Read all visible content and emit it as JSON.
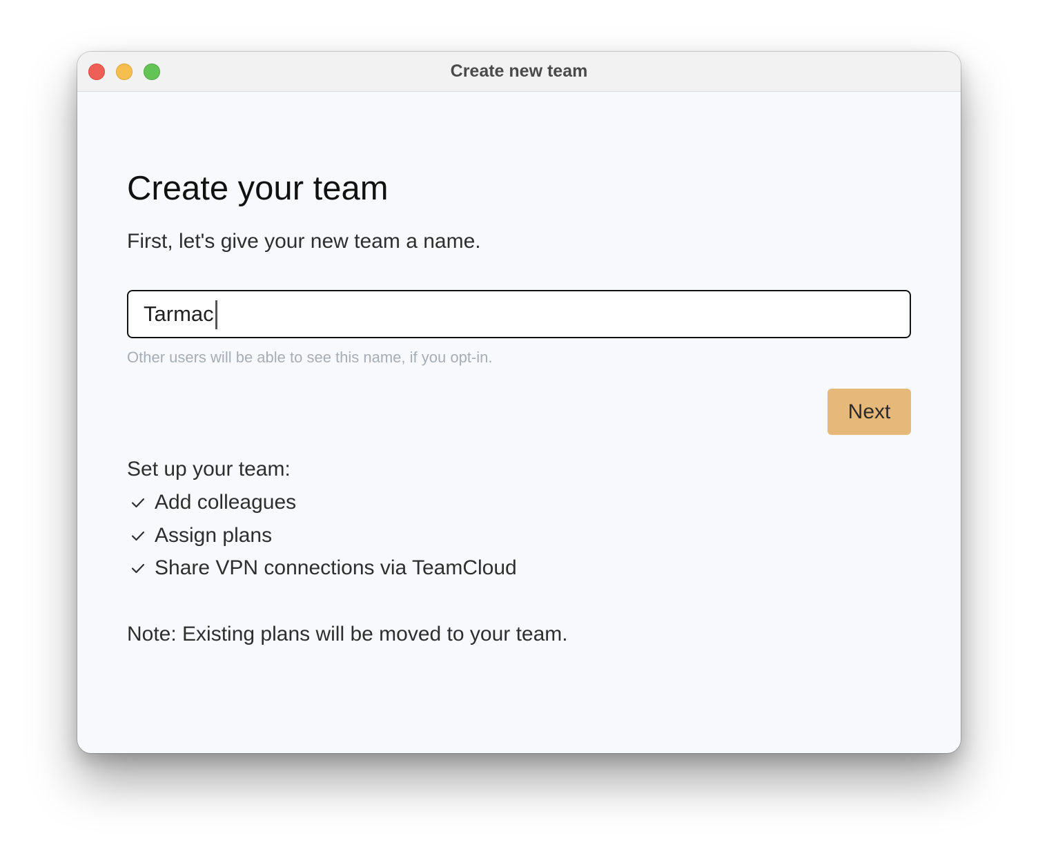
{
  "window": {
    "title": "Create new team"
  },
  "form": {
    "heading": "Create your team",
    "subheading": "First, let's give your new team a name.",
    "team_name_value": "Tarmac",
    "hint": "Other users will be able to see this name, if you opt-in.",
    "next_label": "Next"
  },
  "setup": {
    "title": "Set up your team:",
    "items": [
      {
        "label": "Add colleagues",
        "icon": "check-icon"
      },
      {
        "label": "Assign plans",
        "icon": "check-icon"
      },
      {
        "label": "Share VPN connections via TeamCloud",
        "icon": "check-icon"
      }
    ]
  },
  "note": "Note: Existing plans will be moved to your team.",
  "colors": {
    "accent_button": "#e6b97a",
    "traffic_close": "#ee5f57",
    "traffic_minimize": "#f6be4f",
    "traffic_maximize": "#61c454"
  }
}
